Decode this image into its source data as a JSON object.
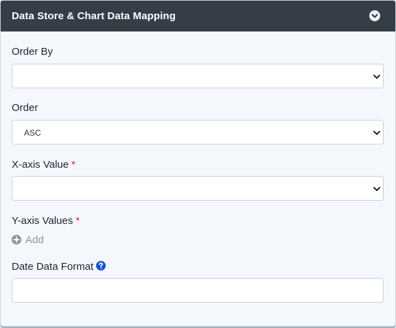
{
  "panel": {
    "title": "Data Store & Chart Data Mapping"
  },
  "fields": {
    "order_by": {
      "label": "Order By",
      "value": ""
    },
    "order": {
      "label": "Order",
      "value": "ASC"
    },
    "x_axis": {
      "label": "X-axis Value",
      "required_marker": "*",
      "value": ""
    },
    "y_axis": {
      "label": "Y-axis Values",
      "required_marker": "*",
      "add_label": "Add"
    },
    "date_format": {
      "label": "Date Data Format",
      "value": ""
    }
  },
  "colors": {
    "header_bg": "#353d47",
    "panel_bg": "#f4f8fc",
    "required": "#d9263a",
    "help_icon": "#1a4fd6",
    "add_icon": "#8d959c"
  },
  "icons": {
    "collapse": "chevron-down-circle-icon",
    "select_arrow": "chevron-down-icon",
    "add": "plus-circle-icon",
    "help": "question-circle-icon"
  }
}
